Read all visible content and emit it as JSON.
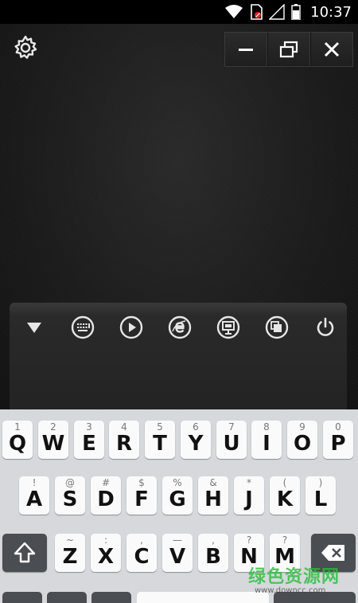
{
  "status_bar": {
    "time": "10:37",
    "icons": [
      "wifi-icon",
      "sim-blocked-icon",
      "signal-icon",
      "battery-icon"
    ]
  },
  "toolbar": {
    "buttons": [
      "collapse-triangle-icon",
      "keyboard-icon",
      "play-icon",
      "browser-icon",
      "presentation-icon",
      "window-switch-icon",
      "power-icon"
    ]
  },
  "keyboard": {
    "row1": [
      {
        "hint": "1",
        "main": "Q"
      },
      {
        "hint": "2",
        "main": "W"
      },
      {
        "hint": "3",
        "main": "E"
      },
      {
        "hint": "4",
        "main": "R"
      },
      {
        "hint": "5",
        "main": "T"
      },
      {
        "hint": "6",
        "main": "Y"
      },
      {
        "hint": "7",
        "main": "U"
      },
      {
        "hint": "8",
        "main": "I"
      },
      {
        "hint": "9",
        "main": "O"
      },
      {
        "hint": "0",
        "main": "P"
      }
    ],
    "row2": [
      {
        "hint": "!",
        "main": "A"
      },
      {
        "hint": "@",
        "main": "S"
      },
      {
        "hint": "#",
        "main": "D"
      },
      {
        "hint": "$",
        "main": "F"
      },
      {
        "hint": "%",
        "main": "G"
      },
      {
        "hint": "&",
        "main": "H"
      },
      {
        "hint": "*",
        "main": "J"
      },
      {
        "hint": "(",
        "main": "K"
      },
      {
        "hint": ")",
        "main": "L"
      }
    ],
    "row3": [
      {
        "hint": "~",
        "main": "Z"
      },
      {
        "hint": ":",
        "main": "X"
      },
      {
        "hint": ",",
        "main": "C"
      },
      {
        "hint": "—",
        "main": "V"
      },
      {
        "hint": ",",
        "main": "B"
      },
      {
        "hint": "?",
        "main": "N"
      },
      {
        "hint": "?",
        "main": "M"
      }
    ]
  },
  "watermark": {
    "title": "绿色资源网",
    "url": "www.downcc.com"
  },
  "colors": {
    "keyboard_bg": "#d6d8dc",
    "key_bg": "#fafafa",
    "dark_key_bg": "#4a4d51",
    "watermark_green": "#28be3c"
  }
}
